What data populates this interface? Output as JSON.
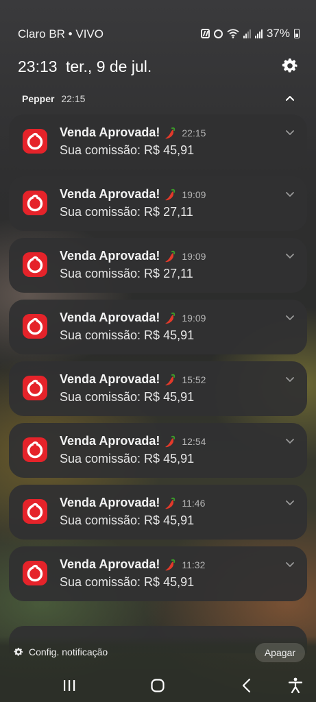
{
  "status_bar": {
    "carrier": "Claro BR • VIVO",
    "battery": "37%",
    "icons": [
      "nfc-icon",
      "alarm-icon",
      "wifi-icon",
      "signal-icon",
      "signal-icon",
      "battery-icon"
    ]
  },
  "header": {
    "time": "23:13",
    "date": "ter., 9 de jul."
  },
  "group": {
    "app_name": "Pepper",
    "time": "22:15"
  },
  "notifications": [
    {
      "title": "Venda Aprovada!",
      "time": "22:15",
      "body": "Sua comissão: R$ 45,91"
    },
    {
      "title": "Venda Aprovada!",
      "time": "19:09",
      "body": "Sua comissão: R$ 27,11"
    },
    {
      "title": "Venda Aprovada!",
      "time": "19:09",
      "body": "Sua comissão: R$ 27,11"
    },
    {
      "title": "Venda Aprovada!",
      "time": "19:09",
      "body": "Sua comissão: R$ 45,91"
    },
    {
      "title": "Venda Aprovada!",
      "time": "15:52",
      "body": "Sua comissão: R$ 45,91"
    },
    {
      "title": "Venda Aprovada!",
      "time": "12:54",
      "body": "Sua comissão: R$ 45,91"
    },
    {
      "title": "Venda Aprovada!",
      "time": "11:46",
      "body": "Sua comissão: R$ 45,91"
    },
    {
      "title": "Venda Aprovada!",
      "time": "11:32",
      "body": "Sua comissão: R$ 45,91"
    }
  ],
  "footer": {
    "settings_label": "Config. notificação",
    "clear_label": "Apagar"
  },
  "colors": {
    "app_icon": "#e5232a",
    "card_bg": "#303032"
  },
  "nav": {
    "buttons": [
      "recent-apps-icon",
      "home-icon",
      "back-icon",
      "accessibility-icon"
    ]
  }
}
